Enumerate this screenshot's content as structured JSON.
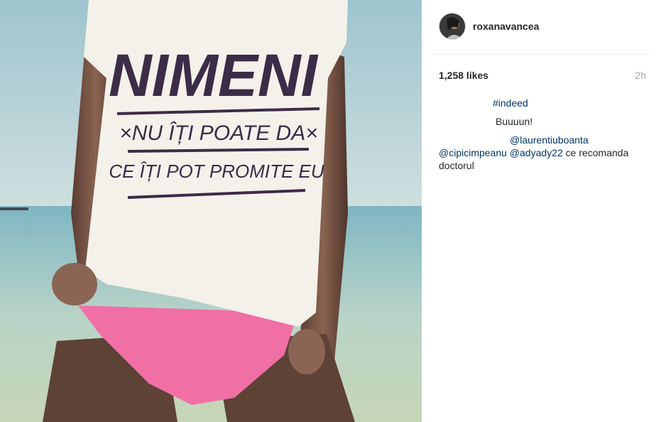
{
  "post": {
    "username": "roxanavancea",
    "likes": "1,258 likes",
    "time": "2h",
    "shirt_text": {
      "line1": "NIMENI",
      "line2": "×NU ÎȚI POATE DA×",
      "line3": "CE ÎȚI POT PROMITE EU"
    }
  },
  "comments": [
    {
      "hashtag": "#indeed"
    },
    {
      "text": "Buuuun!"
    },
    {
      "mention1": "@laurentiuboanta",
      "mention2": "@cipicimpeanu",
      "mention3": "@adyady22",
      "text": " ce recomanda doctorul"
    }
  ],
  "colors": {
    "link": "#003569",
    "text": "#262626",
    "muted": "#a5a7aa",
    "bikini": "#f06fa4",
    "shirt": "#f4f1ea"
  },
  "icons": {
    "avatar": "user-avatar-image"
  }
}
